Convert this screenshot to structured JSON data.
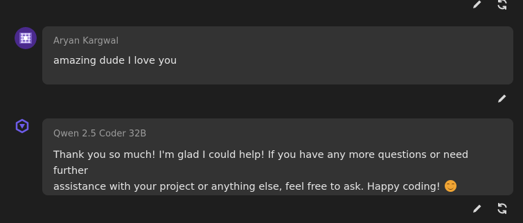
{
  "messages": [
    {
      "role": "user",
      "sender": "Aryan Kargwal",
      "text": "amazing dude I love you",
      "avatar_icon": "user-avatar-icon",
      "actions": [
        "edit"
      ]
    },
    {
      "role": "assistant",
      "sender": "Qwen 2.5 Coder 32B",
      "text_line1": "Thank you so much! I'm glad I could help! If you have any more questions or need further",
      "text_line2": "assistance with your project or anything else, feel free to ask. Happy coding!",
      "emoji": "smiling-face-icon",
      "avatar_icon": "qwen-logo-icon",
      "actions": [
        "edit",
        "regenerate"
      ]
    }
  ],
  "top_actions": [
    "edit",
    "regenerate"
  ],
  "colors": {
    "background": "#1e1e1e",
    "bubble": "#333333",
    "sender_text": "#9c9c9c",
    "message_text": "#e6e6e6",
    "icon": "#d9d9d9",
    "qwen_logo": "#6d5ce8"
  }
}
